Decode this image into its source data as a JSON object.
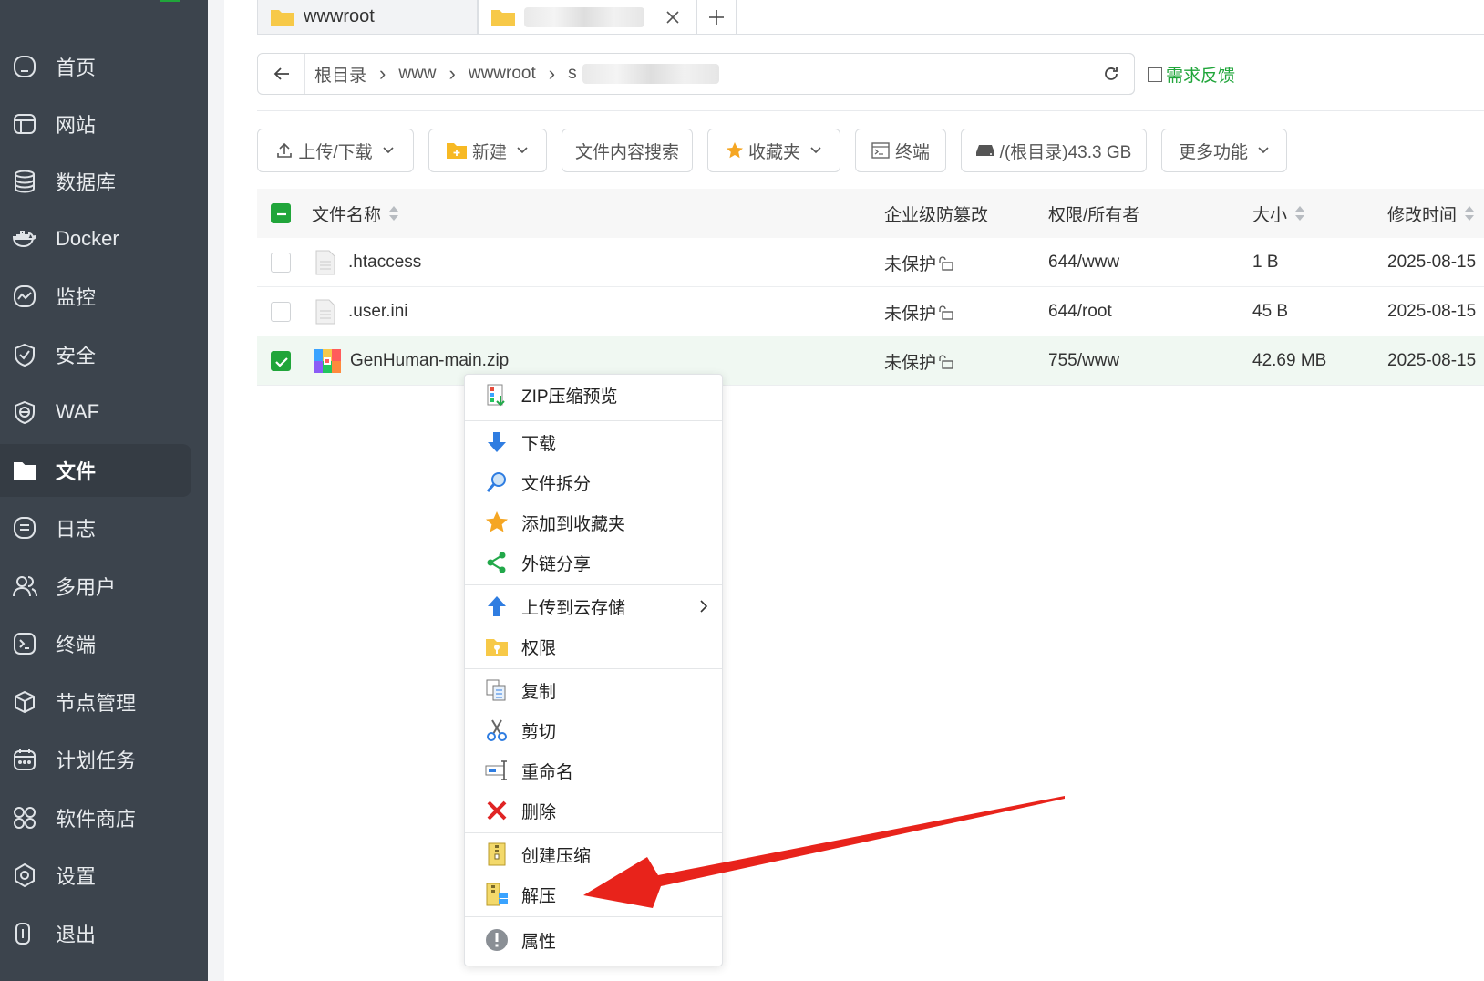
{
  "sidebar": {
    "items": [
      {
        "label": "首页",
        "icon": "home-icon"
      },
      {
        "label": "网站",
        "icon": "website-icon"
      },
      {
        "label": "数据库",
        "icon": "database-icon"
      },
      {
        "label": "Docker",
        "icon": "docker-icon"
      },
      {
        "label": "监控",
        "icon": "monitor-icon"
      },
      {
        "label": "安全",
        "icon": "shield-icon"
      },
      {
        "label": "WAF",
        "icon": "waf-icon"
      },
      {
        "label": "文件",
        "icon": "folder-icon",
        "active": true
      },
      {
        "label": "日志",
        "icon": "log-icon"
      },
      {
        "label": "多用户",
        "icon": "users-icon"
      },
      {
        "label": "终端",
        "icon": "terminal-icon"
      },
      {
        "label": "节点管理",
        "icon": "node-icon"
      },
      {
        "label": "计划任务",
        "icon": "calendar-icon"
      },
      {
        "label": "软件商店",
        "icon": "store-icon"
      },
      {
        "label": "设置",
        "icon": "settings-icon"
      },
      {
        "label": "退出",
        "icon": "logout-icon"
      }
    ]
  },
  "tabs": [
    {
      "label": "wwwroot"
    },
    {
      "label": ""
    }
  ],
  "breadcrumb": {
    "parts": [
      "根目录",
      "www",
      "wwwroot",
      "s"
    ]
  },
  "feedback_label": "需求反馈",
  "toolbar": {
    "upload": "上传/下载",
    "new": "新建",
    "search": "文件内容搜索",
    "favorites": "收藏夹",
    "terminal": "终端",
    "disk": "/(根目录)43.3 GB",
    "more": "更多功能"
  },
  "table": {
    "headers": {
      "name": "文件名称",
      "protect": "企业级防篡改",
      "perm": "权限/所有者",
      "size": "大小",
      "mtime": "修改时间"
    },
    "rows": [
      {
        "name": ".htaccess",
        "protect": "未保护",
        "perm": "644/www",
        "size": "1 B",
        "mtime": "2025-08-15",
        "checked": false
      },
      {
        "name": ".user.ini",
        "protect": "未保护",
        "perm": "644/root",
        "size": "45 B",
        "mtime": "2025-08-15",
        "checked": false
      },
      {
        "name": "GenHuman-main.zip",
        "protect": "未保护",
        "perm": "755/www",
        "size": "42.69 MB",
        "mtime": "2025-08-15",
        "checked": true
      }
    ]
  },
  "context_menu": {
    "items": [
      {
        "label": "ZIP压缩预览",
        "icon": "zip-preview-icon"
      },
      {
        "label": "下载",
        "icon": "download-icon"
      },
      {
        "label": "文件拆分",
        "icon": "split-icon"
      },
      {
        "label": "添加到收藏夹",
        "icon": "star-icon"
      },
      {
        "label": "外链分享",
        "icon": "share-icon"
      },
      {
        "label": "上传到云存储",
        "icon": "cloud-upload-icon"
      },
      {
        "label": "权限",
        "icon": "permission-icon"
      },
      {
        "label": "复制",
        "icon": "copy-icon"
      },
      {
        "label": "剪切",
        "icon": "cut-icon"
      },
      {
        "label": "重命名",
        "icon": "rename-icon"
      },
      {
        "label": "删除",
        "icon": "delete-icon"
      },
      {
        "label": "创建压缩",
        "icon": "compress-icon"
      },
      {
        "label": "解压",
        "icon": "extract-icon"
      },
      {
        "label": "属性",
        "icon": "info-icon"
      }
    ]
  },
  "colors": {
    "sidebar_bg": "#3c444d",
    "accent_green": "#20a53a",
    "annotation_red": "#e8231b"
  }
}
